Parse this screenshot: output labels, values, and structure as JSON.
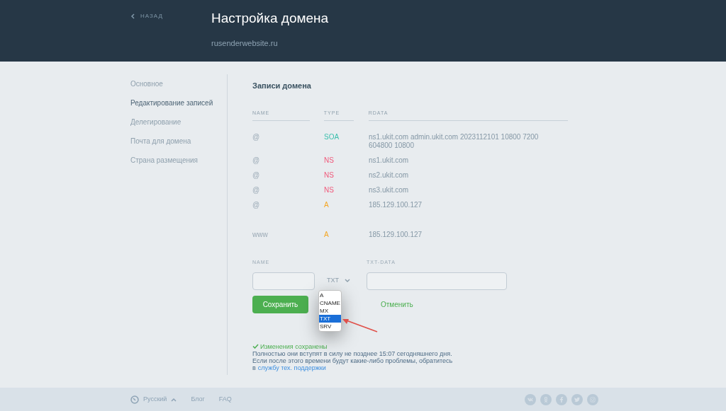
{
  "header": {
    "back_link": "НАЗАД",
    "title": "Настройка домена",
    "domain": "rusenderwebsite.ru"
  },
  "sidebar": {
    "items": [
      {
        "label": "Основное",
        "selected": false
      },
      {
        "label": "Редактирование записей",
        "selected": true
      },
      {
        "label": "Делегирование",
        "selected": false
      },
      {
        "label": "Почта для домена",
        "selected": false
      },
      {
        "label": "Страна размещения",
        "selected": false
      }
    ]
  },
  "records": {
    "title": "Записи домена",
    "columns": [
      "NAME",
      "TYPE",
      "RDATA"
    ],
    "rows": [
      {
        "name": "@",
        "type": "SOA",
        "color": "#3bbfad",
        "rdata": "ns1.ukit.com admin.ukit.com 2023112101 10800 7200 604800 10800"
      },
      {
        "name": "@",
        "type": "NS",
        "color": "#f0587a",
        "rdata": "ns1.ukit.com"
      },
      {
        "name": "@",
        "type": "NS",
        "color": "#f0587a",
        "rdata": "ns2.ukit.com"
      },
      {
        "name": "@",
        "type": "NS",
        "color": "#f0587a",
        "rdata": "ns3.ukit.com"
      },
      {
        "name": "@",
        "type": "A",
        "color": "#f5a623",
        "rdata": "185.129.100.127"
      },
      {
        "name": "www",
        "type": "A",
        "color": "#f5a623",
        "rdata": "185.129.100.127"
      }
    ]
  },
  "form": {
    "name_label": "NAME",
    "data_label": "TXT-DATA",
    "type_value": "TXT",
    "type_options": [
      {
        "label": "A",
        "selected": false
      },
      {
        "label": "CNAME",
        "selected": false
      },
      {
        "label": "MX",
        "selected": false
      },
      {
        "label": "TXT",
        "selected": true
      },
      {
        "label": "SRV",
        "selected": false
      }
    ],
    "save_button": "Сохранить",
    "cancel_link": "Отменить"
  },
  "notice": {
    "status": "Изменения сохранены",
    "line_1": "Полностью они вступят в силу не позднее 15:07 сегодняшнего дня.",
    "line_2": "Если после этого времени будут какие-либо проблемы, обратитесь",
    "line_3_prefix": "в",
    "support_link": "службу тех. поддержки"
  },
  "footer": {
    "language": "Русский",
    "links": [
      "Блог",
      "FAQ"
    ]
  }
}
